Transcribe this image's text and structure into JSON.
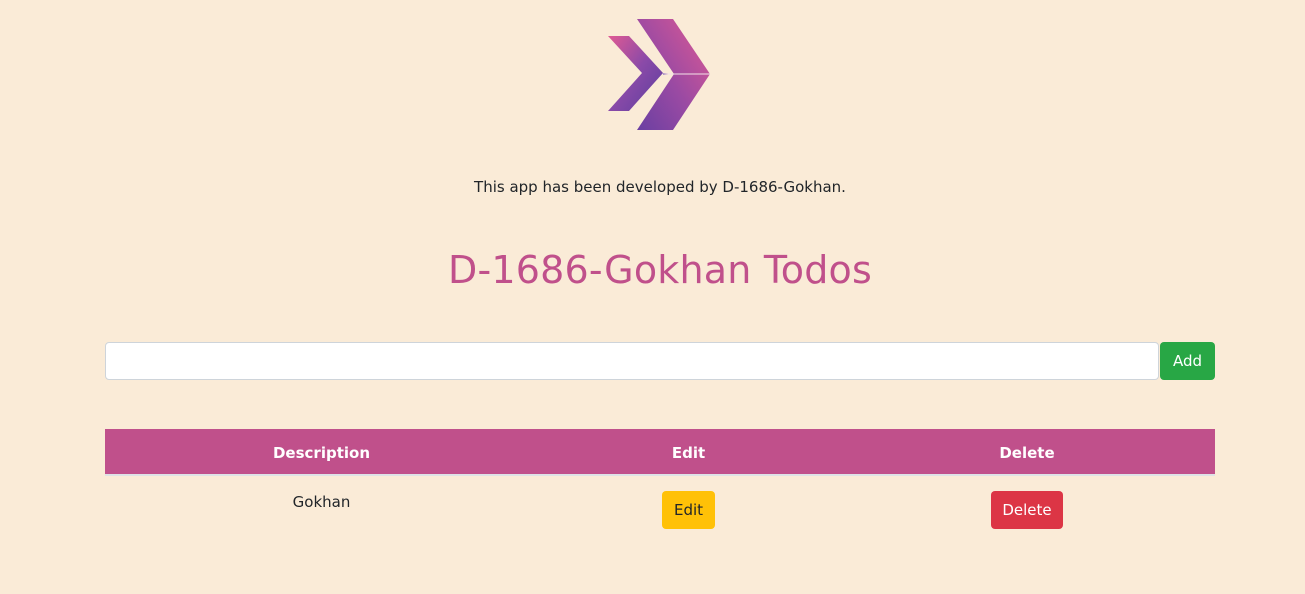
{
  "header": {
    "logo_icon": "chevron-arrows-logo",
    "credit_text": "This app has been developed by D-1686-Gokhan.",
    "title": "D-1686-Gokhan Todos"
  },
  "todo_form": {
    "input_value": "",
    "input_placeholder": "",
    "add_label": "Add"
  },
  "table": {
    "columns": [
      "Description",
      "Edit",
      "Delete"
    ],
    "rows": [
      {
        "description": "Gokhan",
        "edit_label": "Edit",
        "delete_label": "Delete"
      }
    ]
  },
  "colors": {
    "background": "#faebd7",
    "accent": "#c0508b",
    "add_button": "#28a745",
    "edit_button": "#ffc107",
    "delete_button": "#dc3545"
  }
}
